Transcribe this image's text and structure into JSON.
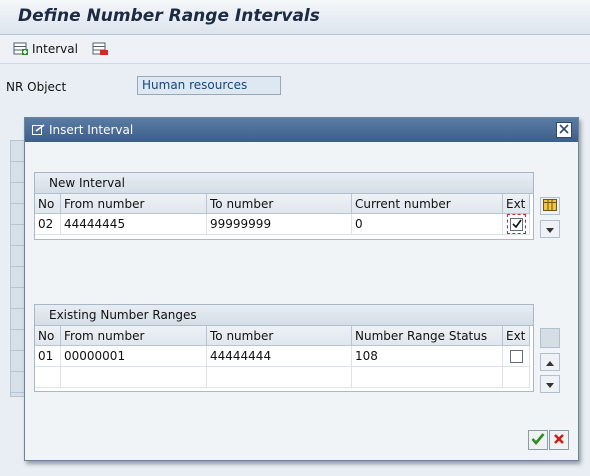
{
  "window": {
    "title": "Define Number Range Intervals"
  },
  "toolbar": {
    "interval_label": "Interval"
  },
  "nr_object": {
    "label": "NR Object",
    "value": "Human resources"
  },
  "dialog": {
    "title": "Insert Interval",
    "new_interval": {
      "heading": "New Interval",
      "columns": [
        "No",
        "From number",
        "To number",
        "Current number",
        "Ext"
      ],
      "row": {
        "no": "02",
        "from": "44444445",
        "to": "99999999",
        "current": "0",
        "ext_checked": true
      }
    },
    "existing": {
      "heading": "Existing Number Ranges",
      "columns": [
        "No",
        "From number",
        "To number",
        "Number Range Status",
        "Ext"
      ],
      "rows": [
        {
          "no": "01",
          "from": "00000001",
          "to": "44444444",
          "status": "108",
          "ext_checked": false
        }
      ]
    }
  },
  "colors": {
    "dialog_title": "#3c5f8b",
    "confirm": "#2e8b22",
    "cancel": "#c8201c"
  }
}
